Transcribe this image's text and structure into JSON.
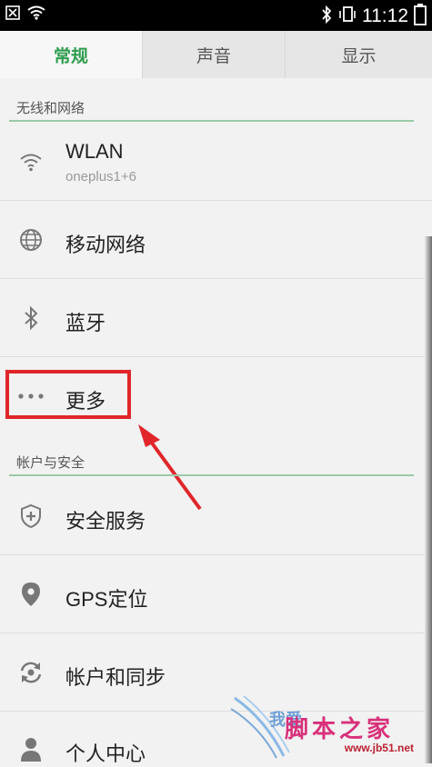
{
  "status_bar": {
    "time": "11:12",
    "left_icons": [
      "close-box-icon",
      "wifi-icon"
    ],
    "right_icons": [
      "bluetooth-icon",
      "vibrate-icon",
      "battery-icon"
    ]
  },
  "tabs": [
    {
      "label": "常规",
      "active": true
    },
    {
      "label": "声音",
      "active": false
    },
    {
      "label": "显示",
      "active": false
    }
  ],
  "sections": {
    "network": {
      "title": "无线和网络"
    },
    "account": {
      "title": "帐户与安全"
    }
  },
  "items": {
    "wlan": {
      "label": "WLAN",
      "sub": "oneplus1+6",
      "icon": "wifi-icon"
    },
    "mobile": {
      "label": "移动网络",
      "icon": "globe-icon"
    },
    "bluetooth": {
      "label": "蓝牙",
      "icon": "bluetooth-icon"
    },
    "more": {
      "label": "更多",
      "icon": "more-dots-icon"
    },
    "security": {
      "label": "安全服务",
      "icon": "shield-plus-icon"
    },
    "gps": {
      "label": "GPS定位",
      "icon": "location-pin-icon"
    },
    "sync": {
      "label": "帐户和同步",
      "icon": "sync-icon"
    },
    "personal": {
      "label": "个人中心",
      "icon": "person-icon"
    }
  },
  "watermark": {
    "text": "脚本之家",
    "left_text": "我爱",
    "url": "www.jb51.net"
  },
  "colors": {
    "accent": "#2d9c4c",
    "highlight": "#e0262a",
    "section_rule": "#9ccaa8"
  }
}
